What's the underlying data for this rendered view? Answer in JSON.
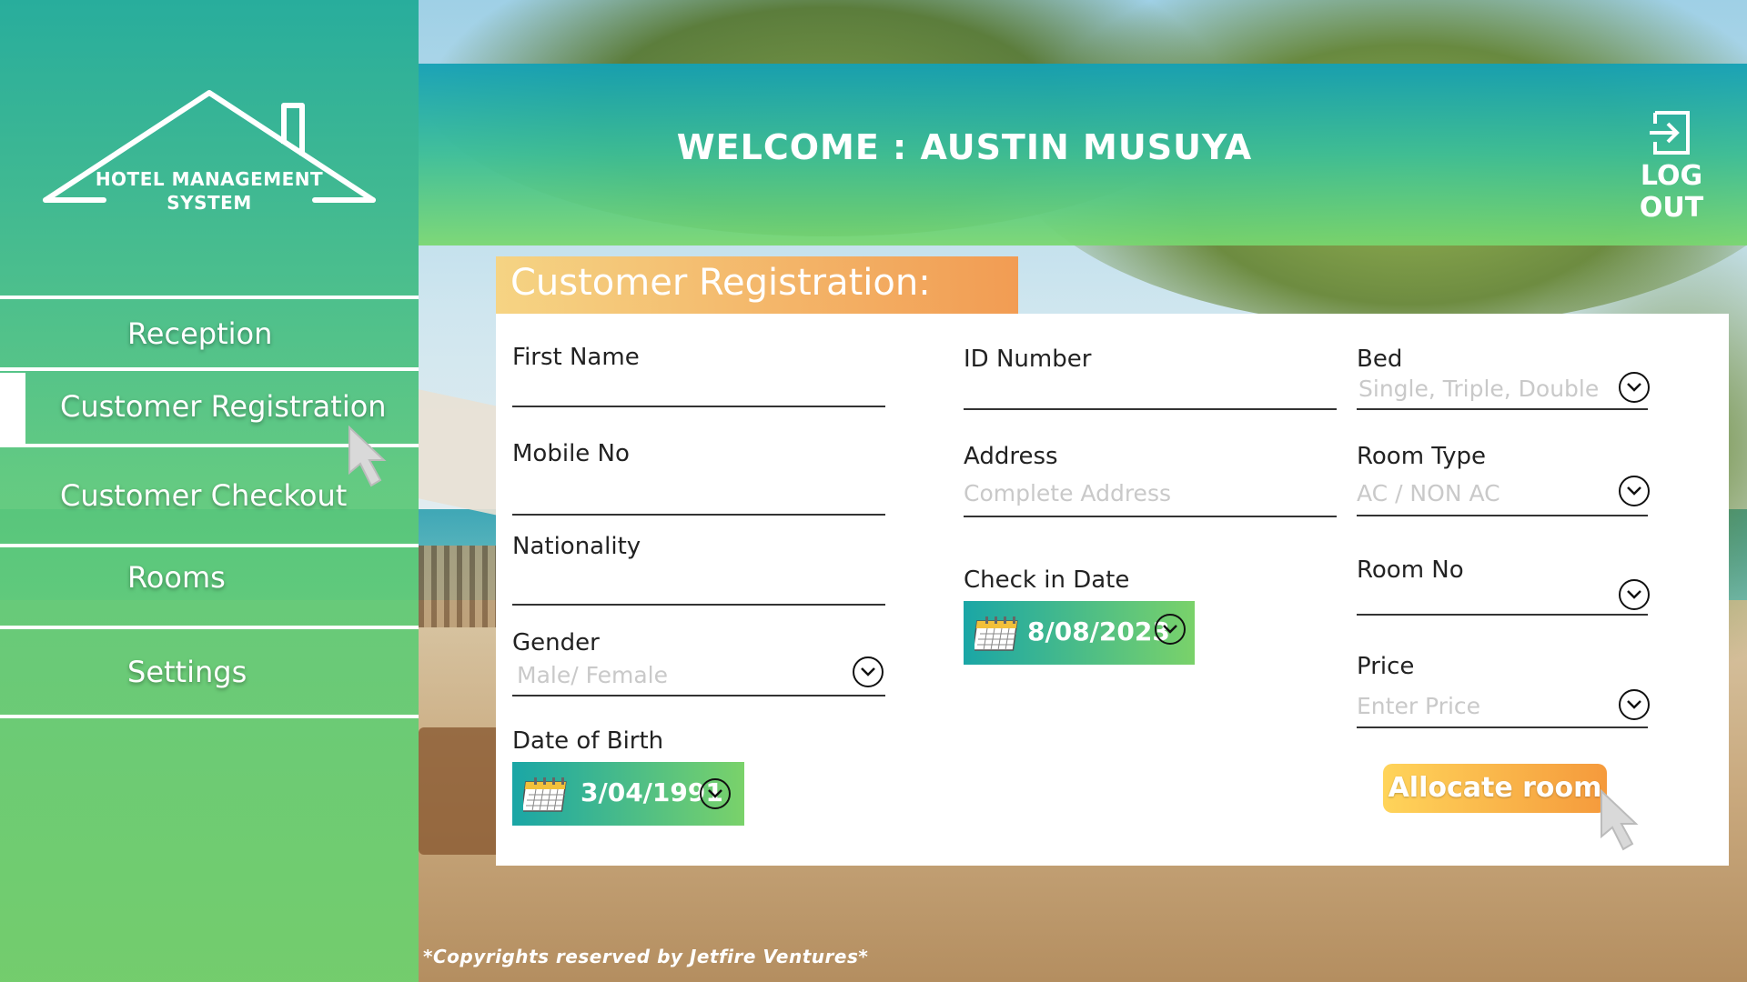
{
  "sidebar": {
    "logo_line1": "HOTEL MANAGEMENT",
    "logo_line2": "SYSTEM",
    "items": [
      {
        "label": "Reception"
      },
      {
        "label": "Customer Registration"
      },
      {
        "label": "Customer Checkout"
      },
      {
        "label": "Rooms"
      },
      {
        "label": "Settings"
      }
    ],
    "active_item": "Customer Registration"
  },
  "header": {
    "welcome": "WELCOME : AUSTIN MUSUYA",
    "logout_label": "LOG OUT",
    "logout_icon": "logout-icon"
  },
  "form": {
    "title": "Customer Registration:",
    "first_name": {
      "label": "First Name",
      "value": ""
    },
    "mobile_no": {
      "label": "Mobile No",
      "value": ""
    },
    "nationality": {
      "label": "Nationality",
      "value": ""
    },
    "gender": {
      "label": "Gender",
      "placeholder": "Male/ Female"
    },
    "date_of_birth": {
      "label": "Date of Birth",
      "value": "3/04/1991"
    },
    "id_number": {
      "label": "ID Number",
      "value": ""
    },
    "address": {
      "label": "Address",
      "placeholder": "Complete Address"
    },
    "check_in_date": {
      "label": "Check in Date",
      "value": "8/08/2023"
    },
    "bed": {
      "label": "Bed",
      "placeholder": "Single, Triple, Double"
    },
    "room_type": {
      "label": "Room Type",
      "placeholder": "AC / NON AC"
    },
    "room_no": {
      "label": "Room No",
      "value": ""
    },
    "price": {
      "label": "Price",
      "placeholder": "Enter Price"
    },
    "allocate_button": "Allocate room"
  },
  "footer": {
    "copyright": "*Copyrights reserved by Jetfire Ventures*"
  },
  "colors": {
    "sidebar_top": "#1eaa96",
    "sidebar_bottom": "#6ed26e",
    "header_accent": "#14a0b4",
    "title_orange": "#f59646",
    "button_yellow": "#ffd45a",
    "button_orange": "#f59a3c"
  }
}
